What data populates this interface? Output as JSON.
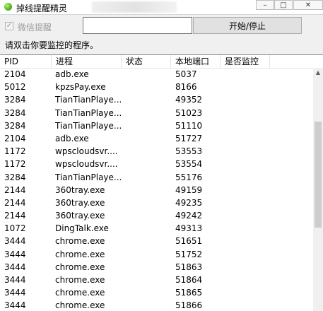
{
  "window": {
    "title": "掉线提醒精灵"
  },
  "controls": {
    "wechat_label": "微信提醒",
    "start_stop_label": "开始/停止",
    "input_value": "",
    "hint": "请双击你要监控的程序。"
  },
  "columns": [
    "PID",
    "进程",
    "状态",
    "本地端口",
    "是否监控"
  ],
  "rows": [
    {
      "pid": "2104",
      "process": "adb.exe",
      "state": "",
      "port": "5037",
      "monitor": ""
    },
    {
      "pid": "5012",
      "process": "kpzsPay.exe",
      "state": "",
      "port": "8166",
      "monitor": ""
    },
    {
      "pid": "3284",
      "process": "TianTianPlaye...",
      "state": "",
      "port": "49352",
      "monitor": ""
    },
    {
      "pid": "3284",
      "process": "TianTianPlaye...",
      "state": "",
      "port": "51023",
      "monitor": ""
    },
    {
      "pid": "3284",
      "process": "TianTianPlaye...",
      "state": "",
      "port": "51110",
      "monitor": ""
    },
    {
      "pid": "2104",
      "process": "adb.exe",
      "state": "",
      "port": "51727",
      "monitor": ""
    },
    {
      "pid": "1172",
      "process": "wpscloudsvr....",
      "state": "",
      "port": "53553",
      "monitor": ""
    },
    {
      "pid": "1172",
      "process": "wpscloudsvr....",
      "state": "",
      "port": "53554",
      "monitor": ""
    },
    {
      "pid": "3284",
      "process": "TianTianPlaye...",
      "state": "",
      "port": "55176",
      "monitor": ""
    },
    {
      "pid": "2144",
      "process": "360tray.exe",
      "state": "",
      "port": "49159",
      "monitor": ""
    },
    {
      "pid": "2144",
      "process": "360tray.exe",
      "state": "",
      "port": "49235",
      "monitor": ""
    },
    {
      "pid": "2144",
      "process": "360tray.exe",
      "state": "",
      "port": "49242",
      "monitor": ""
    },
    {
      "pid": "1072",
      "process": "DingTalk.exe",
      "state": "",
      "port": "49313",
      "monitor": ""
    },
    {
      "pid": "3444",
      "process": "chrome.exe",
      "state": "",
      "port": "51651",
      "monitor": ""
    },
    {
      "pid": "3444",
      "process": "chrome.exe",
      "state": "",
      "port": "51752",
      "monitor": ""
    },
    {
      "pid": "3444",
      "process": "chrome.exe",
      "state": "",
      "port": "51863",
      "monitor": ""
    },
    {
      "pid": "3444",
      "process": "chrome.exe",
      "state": "",
      "port": "51864",
      "monitor": ""
    },
    {
      "pid": "3444",
      "process": "chrome.exe",
      "state": "",
      "port": "51865",
      "monitor": ""
    },
    {
      "pid": "3444",
      "process": "chrome.exe",
      "state": "",
      "port": "51866",
      "monitor": ""
    }
  ],
  "icons": {
    "app": "app-icon",
    "minimize": "minimize-icon",
    "maximize": "maximize-icon",
    "close": "close-icon",
    "checkbox": "checkbox-icon",
    "scroll_up": "scroll-up-arrow-icon"
  }
}
